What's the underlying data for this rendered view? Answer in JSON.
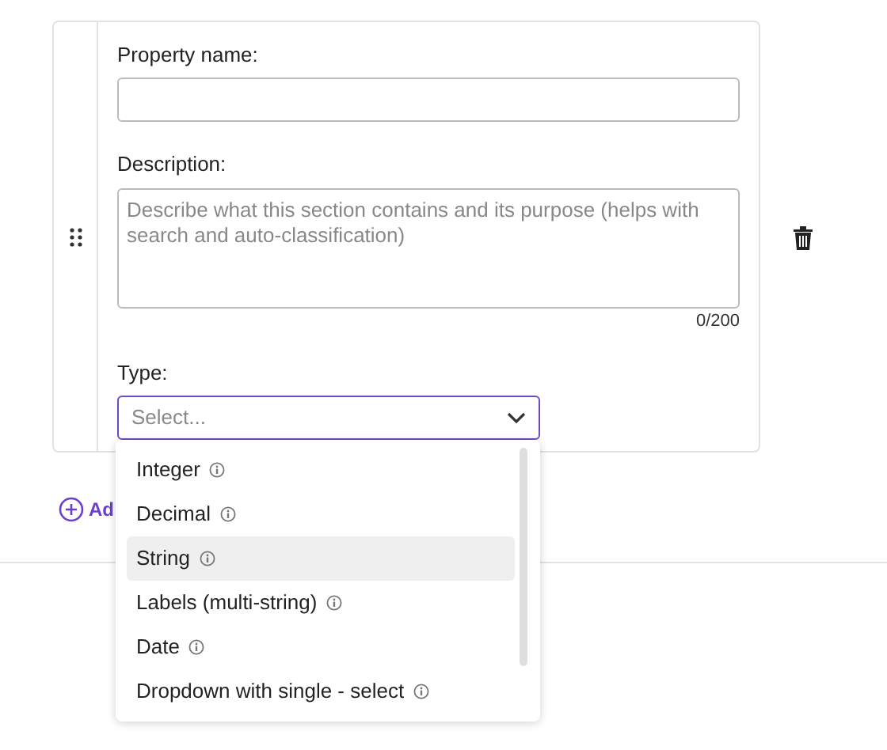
{
  "property_name": {
    "label": "Property name:"
  },
  "description": {
    "label": "Description:",
    "placeholder": "Describe what this section contains and its purpose (helps with search and auto-classification)",
    "counter": "0/200"
  },
  "type": {
    "label": "Type:",
    "placeholder": "Select...",
    "expanded": true,
    "options": [
      {
        "label": "Integer",
        "selected": false
      },
      {
        "label": "Decimal",
        "selected": false
      },
      {
        "label": "String",
        "selected": true
      },
      {
        "label": "Labels (multi-string)",
        "selected": false
      },
      {
        "label": "Date",
        "selected": false
      },
      {
        "label": "Dropdown with single - select",
        "selected": false
      }
    ]
  },
  "add_link": "Ad"
}
